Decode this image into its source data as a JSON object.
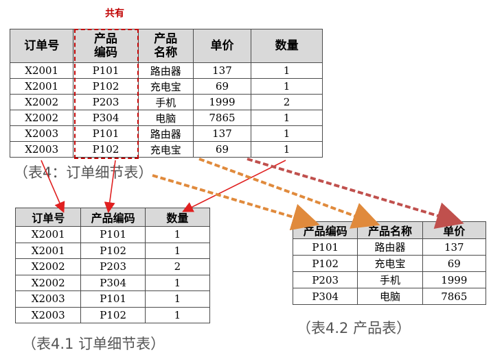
{
  "annotation": {
    "shared_label": "共有"
  },
  "order_detail": {
    "headers": [
      "订单号",
      "产品\n编码",
      "产品\n名称",
      "单价",
      "数量"
    ],
    "rows": [
      [
        "X2001",
        "P101",
        "路由器",
        "137",
        "1"
      ],
      [
        "X2001",
        "P102",
        "充电宝",
        "69",
        "1"
      ],
      [
        "X2002",
        "P203",
        "手机",
        "1999",
        "2"
      ],
      [
        "X2002",
        "P304",
        "电脑",
        "7865",
        "1"
      ],
      [
        "X2003",
        "P101",
        "路由器",
        "137",
        "1"
      ],
      [
        "X2003",
        "P102",
        "充电宝",
        "69",
        "1"
      ]
    ],
    "caption": "（表4：订单细节表）"
  },
  "order_detail_split": {
    "headers": [
      "订单号",
      "产品编码",
      "数量"
    ],
    "rows": [
      [
        "X2001",
        "P101",
        "1"
      ],
      [
        "X2001",
        "P102",
        "1"
      ],
      [
        "X2002",
        "P203",
        "2"
      ],
      [
        "X2002",
        "P304",
        "1"
      ],
      [
        "X2003",
        "P101",
        "1"
      ],
      [
        "X2003",
        "P102",
        "1"
      ]
    ],
    "caption": "（表4.1 订单细节表）"
  },
  "product_table": {
    "headers": [
      "产品编码",
      "产品名称",
      "单价"
    ],
    "rows": [
      [
        "P101",
        "路由器",
        "137"
      ],
      [
        "P102",
        "充电宝",
        "69"
      ],
      [
        "P203",
        "手机",
        "1999"
      ],
      [
        "P304",
        "电脑",
        "7865"
      ]
    ],
    "caption": "（表4.2 产品表）"
  },
  "colors": {
    "red_arrow": "#e02020",
    "orange_arrow": "#e08a3c",
    "dashed_red": "#c0504d",
    "highlight": "#c00000"
  }
}
